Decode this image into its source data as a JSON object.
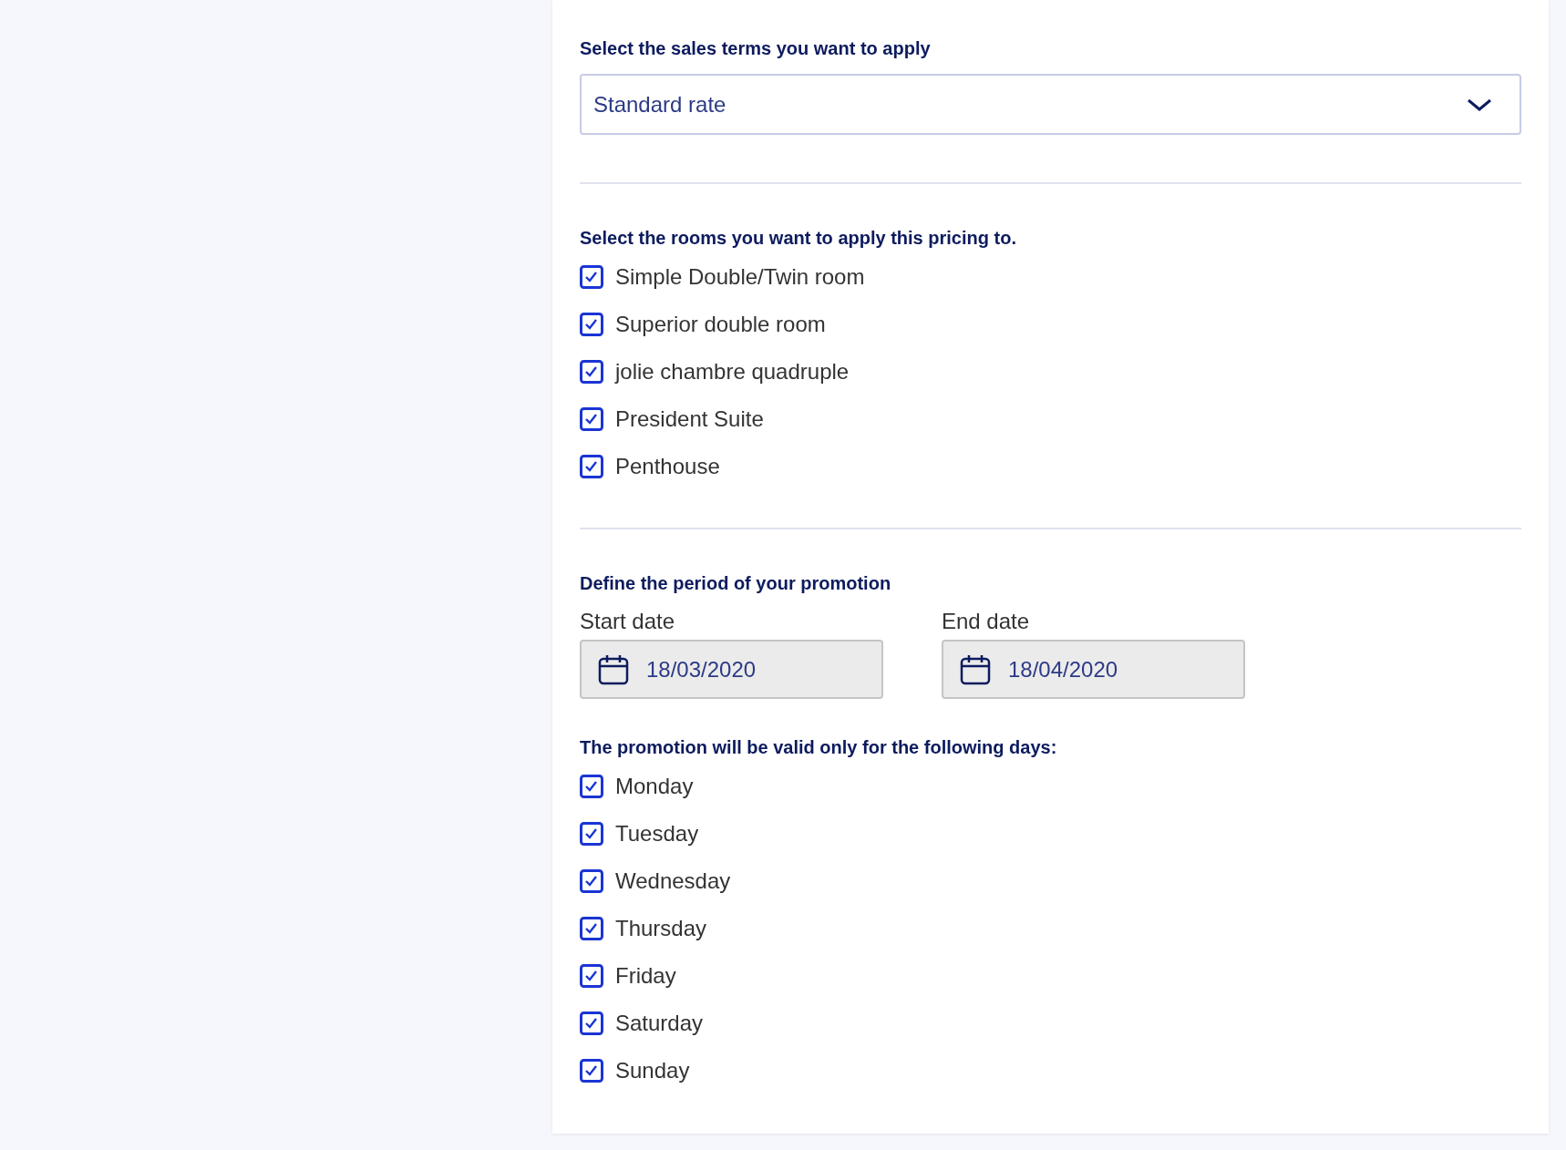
{
  "sales_terms": {
    "label": "Select the sales terms you want to apply",
    "value": "Standard rate"
  },
  "rooms": {
    "label": "Select the rooms you want to apply this pricing to.",
    "items": [
      {
        "label": "Simple Double/Twin room",
        "checked": true
      },
      {
        "label": "Superior double room",
        "checked": true
      },
      {
        "label": "jolie chambre quadruple",
        "checked": true
      },
      {
        "label": "President Suite",
        "checked": true
      },
      {
        "label": "Penthouse",
        "checked": true
      }
    ]
  },
  "period": {
    "label": "Define the period of your promotion",
    "fields": [
      {
        "label": "Start date",
        "value": "18/03/2020"
      },
      {
        "label": "End date",
        "value": "18/04/2020"
      }
    ]
  },
  "days": {
    "label": "The promotion will be valid only for the following days:",
    "items": [
      {
        "label": "Monday",
        "checked": true
      },
      {
        "label": "Tuesday",
        "checked": true
      },
      {
        "label": "Wednesday",
        "checked": true
      },
      {
        "label": "Thursday",
        "checked": true
      },
      {
        "label": "Friday",
        "checked": true
      },
      {
        "label": "Saturday",
        "checked": true
      },
      {
        "label": "Sunday",
        "checked": true
      }
    ]
  }
}
